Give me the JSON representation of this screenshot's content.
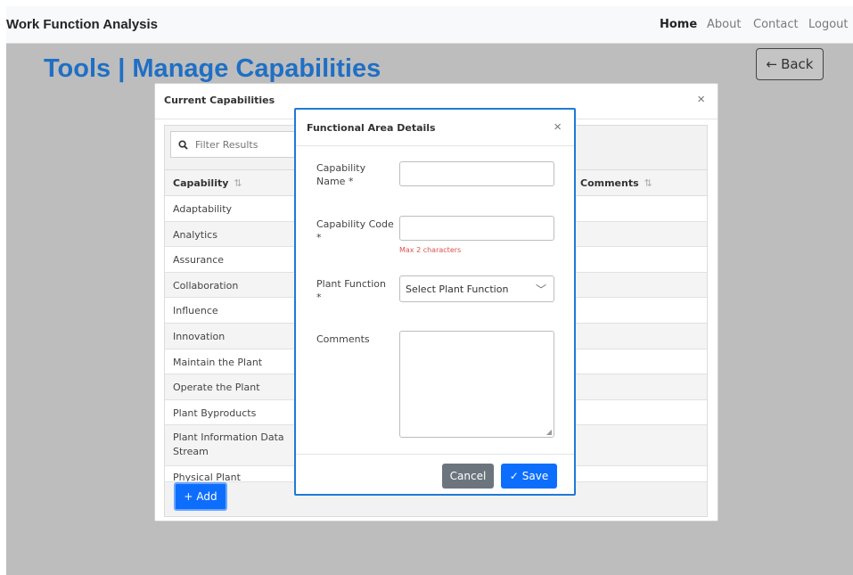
{
  "navbar": {
    "brand": "Work Function Analysis",
    "links": [
      "Home",
      "About",
      "Contact",
      "Logout"
    ]
  },
  "page": {
    "title": "Tools | Manage Capabilities",
    "back_label": "Back",
    "back_icon": "arrow-left-icon"
  },
  "capabilities_modal": {
    "title": "Current Capabilities",
    "close": "×",
    "filter_placeholder": "Filter Results",
    "columns": [
      "Capability",
      "Comments"
    ],
    "sort_glyph": "⇅",
    "rows": [
      "Adaptability",
      "Analytics",
      "Assurance",
      "Collaboration",
      "Influence",
      "Innovation",
      "Maintain the Plant",
      "Operate the Plant",
      "Plant Byproducts",
      "Plant Information Data Stream",
      "Physical Plant"
    ],
    "add_label": "Add"
  },
  "details_modal": {
    "title": "Functional Area Details",
    "close": "×",
    "fields": {
      "name_label": "Capability Name *",
      "code_label": "Capability Code *",
      "code_hint": "Max 2 characters",
      "plant_function_label": "Plant Function *",
      "plant_function_value": "Select Plant Function",
      "comments_label": "Comments"
    },
    "cancel_label": "Cancel",
    "save_label": "Save"
  },
  "colors": {
    "primary": "#0d6efd",
    "title_blue": "#1f6fc4",
    "overlay": "#bdbdbd",
    "danger": "#d9534f"
  }
}
